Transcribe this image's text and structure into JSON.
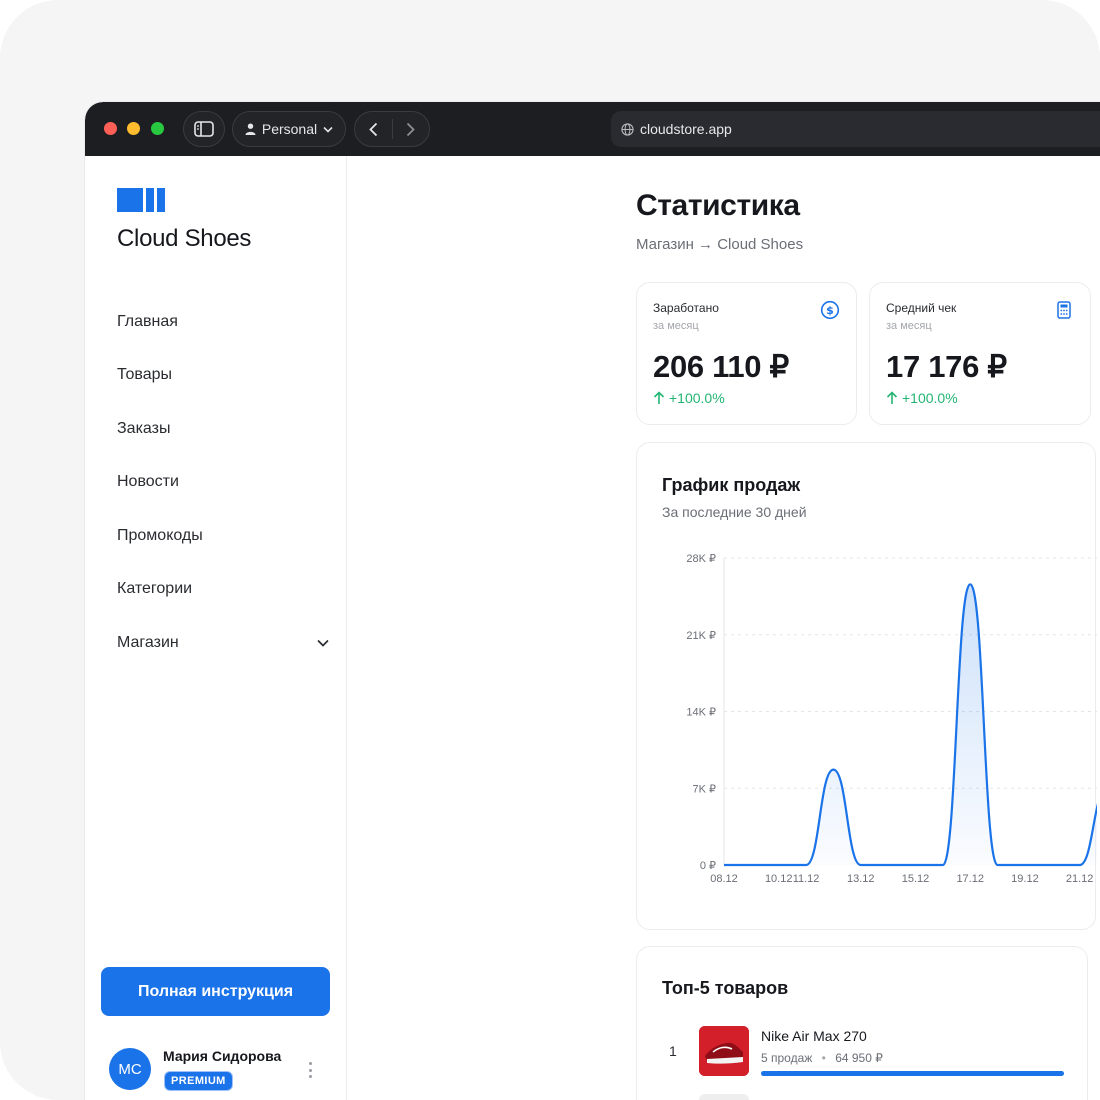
{
  "browser": {
    "profile_label": "Personal",
    "url": "cloudstore.app"
  },
  "sidebar": {
    "brand": "Cloud Shoes",
    "items": [
      {
        "label": "Главная"
      },
      {
        "label": "Товары"
      },
      {
        "label": "Заказы"
      },
      {
        "label": "Новости"
      },
      {
        "label": "Промокоды"
      },
      {
        "label": "Категории"
      },
      {
        "label": "Магазин",
        "expandable": true
      }
    ],
    "guide_button": "Полная инструкция",
    "user": {
      "initials": "МС",
      "name": "Мария Сидорова",
      "badge": "PREMIUM"
    }
  },
  "main": {
    "title": "Статистика",
    "breadcrumb": "Магазин → Cloud Shoes",
    "stats": [
      {
        "label": "Заработано",
        "sub": "за месяц",
        "value": "206 110 ₽",
        "delta": "+100.0%",
        "icon": "dollar-circle-icon"
      },
      {
        "label": "Средний чек",
        "sub": "за месяц",
        "value": "17 176 ₽",
        "delta": "+100.0%",
        "icon": "calculator-icon"
      }
    ],
    "chart": {
      "title": "График продаж",
      "subtitle": "За последние 30 дней"
    },
    "top_products": {
      "title": "Топ-5 товаров",
      "items": [
        {
          "rank": "1",
          "name": "Nike Air Max 270",
          "sales": "5 продаж",
          "sep": "•",
          "revenue": "64 950 ₽",
          "share": 1.0
        }
      ]
    }
  },
  "colors": {
    "accent": "#1a73e8",
    "positive": "#22b573",
    "titlebar": "#1d1e22"
  },
  "chart_data": {
    "type": "area",
    "x": [
      "08.12",
      "09.12",
      "10.12",
      "11.12",
      "12.12",
      "13.12",
      "14.12",
      "15.12",
      "16.12",
      "17.12",
      "18.12",
      "19.12",
      "20.12",
      "21.12",
      "22.12"
    ],
    "tick_labels": [
      "08.12",
      "10.12",
      "11.12",
      "13.12",
      "15.12",
      "17.12",
      "19.12",
      "21.12"
    ],
    "values": [
      0,
      0,
      0,
      0,
      8700,
      0,
      0,
      0,
      0,
      25600,
      0,
      0,
      0,
      0,
      7000
    ],
    "y_ticks": [
      "0 ₽",
      "7K ₽",
      "14K ₽",
      "21K ₽",
      "28K ₽"
    ],
    "ylim": [
      0,
      28000
    ],
    "grid": true
  }
}
